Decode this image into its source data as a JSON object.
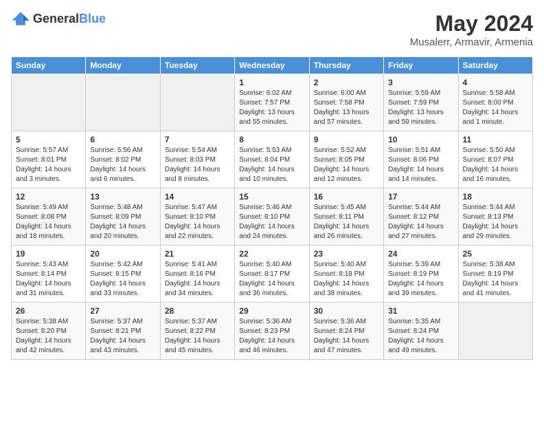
{
  "logo": {
    "general": "General",
    "blue": "Blue"
  },
  "title": {
    "month_year": "May 2024",
    "location": "Musalerr, Armavir, Armenia"
  },
  "days_of_week": [
    "Sunday",
    "Monday",
    "Tuesday",
    "Wednesday",
    "Thursday",
    "Friday",
    "Saturday"
  ],
  "weeks": [
    [
      {
        "day": "",
        "empty": true
      },
      {
        "day": "",
        "empty": true
      },
      {
        "day": "",
        "empty": true
      },
      {
        "day": "1",
        "sunrise": "6:02 AM",
        "sunset": "7:57 PM",
        "daylight": "13 hours and 55 minutes."
      },
      {
        "day": "2",
        "sunrise": "6:00 AM",
        "sunset": "7:58 PM",
        "daylight": "13 hours and 57 minutes."
      },
      {
        "day": "3",
        "sunrise": "5:59 AM",
        "sunset": "7:59 PM",
        "daylight": "13 hours and 59 minutes."
      },
      {
        "day": "4",
        "sunrise": "5:58 AM",
        "sunset": "8:00 PM",
        "daylight": "14 hours and 1 minute."
      }
    ],
    [
      {
        "day": "5",
        "sunrise": "5:57 AM",
        "sunset": "8:01 PM",
        "daylight": "14 hours and 3 minutes."
      },
      {
        "day": "6",
        "sunrise": "5:56 AM",
        "sunset": "8:02 PM",
        "daylight": "14 hours and 6 minutes."
      },
      {
        "day": "7",
        "sunrise": "5:54 AM",
        "sunset": "8:03 PM",
        "daylight": "14 hours and 8 minutes."
      },
      {
        "day": "8",
        "sunrise": "5:53 AM",
        "sunset": "8:04 PM",
        "daylight": "14 hours and 10 minutes."
      },
      {
        "day": "9",
        "sunrise": "5:52 AM",
        "sunset": "8:05 PM",
        "daylight": "14 hours and 12 minutes."
      },
      {
        "day": "10",
        "sunrise": "5:51 AM",
        "sunset": "8:06 PM",
        "daylight": "14 hours and 14 minutes."
      },
      {
        "day": "11",
        "sunrise": "5:50 AM",
        "sunset": "8:07 PM",
        "daylight": "14 hours and 16 minutes."
      }
    ],
    [
      {
        "day": "12",
        "sunrise": "5:49 AM",
        "sunset": "8:08 PM",
        "daylight": "14 hours and 18 minutes."
      },
      {
        "day": "13",
        "sunrise": "5:48 AM",
        "sunset": "8:09 PM",
        "daylight": "14 hours and 20 minutes."
      },
      {
        "day": "14",
        "sunrise": "5:47 AM",
        "sunset": "8:10 PM",
        "daylight": "14 hours and 22 minutes."
      },
      {
        "day": "15",
        "sunrise": "5:46 AM",
        "sunset": "8:10 PM",
        "daylight": "14 hours and 24 minutes."
      },
      {
        "day": "16",
        "sunrise": "5:45 AM",
        "sunset": "8:11 PM",
        "daylight": "14 hours and 26 minutes."
      },
      {
        "day": "17",
        "sunrise": "5:44 AM",
        "sunset": "8:12 PM",
        "daylight": "14 hours and 27 minutes."
      },
      {
        "day": "18",
        "sunrise": "5:44 AM",
        "sunset": "8:13 PM",
        "daylight": "14 hours and 29 minutes."
      }
    ],
    [
      {
        "day": "19",
        "sunrise": "5:43 AM",
        "sunset": "8:14 PM",
        "daylight": "14 hours and 31 minutes."
      },
      {
        "day": "20",
        "sunrise": "5:42 AM",
        "sunset": "8:15 PM",
        "daylight": "14 hours and 33 minutes."
      },
      {
        "day": "21",
        "sunrise": "5:41 AM",
        "sunset": "8:16 PM",
        "daylight": "14 hours and 34 minutes."
      },
      {
        "day": "22",
        "sunrise": "5:40 AM",
        "sunset": "8:17 PM",
        "daylight": "14 hours and 36 minutes."
      },
      {
        "day": "23",
        "sunrise": "5:40 AM",
        "sunset": "8:18 PM",
        "daylight": "14 hours and 38 minutes."
      },
      {
        "day": "24",
        "sunrise": "5:39 AM",
        "sunset": "8:19 PM",
        "daylight": "14 hours and 39 minutes."
      },
      {
        "day": "25",
        "sunrise": "5:38 AM",
        "sunset": "8:19 PM",
        "daylight": "14 hours and 41 minutes."
      }
    ],
    [
      {
        "day": "26",
        "sunrise": "5:38 AM",
        "sunset": "8:20 PM",
        "daylight": "14 hours and 42 minutes."
      },
      {
        "day": "27",
        "sunrise": "5:37 AM",
        "sunset": "8:21 PM",
        "daylight": "14 hours and 43 minutes."
      },
      {
        "day": "28",
        "sunrise": "5:37 AM",
        "sunset": "8:22 PM",
        "daylight": "14 hours and 45 minutes."
      },
      {
        "day": "29",
        "sunrise": "5:36 AM",
        "sunset": "8:23 PM",
        "daylight": "14 hours and 46 minutes."
      },
      {
        "day": "30",
        "sunrise": "5:36 AM",
        "sunset": "8:24 PM",
        "daylight": "14 hours and 47 minutes."
      },
      {
        "day": "31",
        "sunrise": "5:35 AM",
        "sunset": "8:24 PM",
        "daylight": "14 hours and 49 minutes."
      },
      {
        "day": "",
        "empty": true
      }
    ]
  ],
  "labels": {
    "sunrise": "Sunrise:",
    "sunset": "Sunset:",
    "daylight": "Daylight:"
  }
}
